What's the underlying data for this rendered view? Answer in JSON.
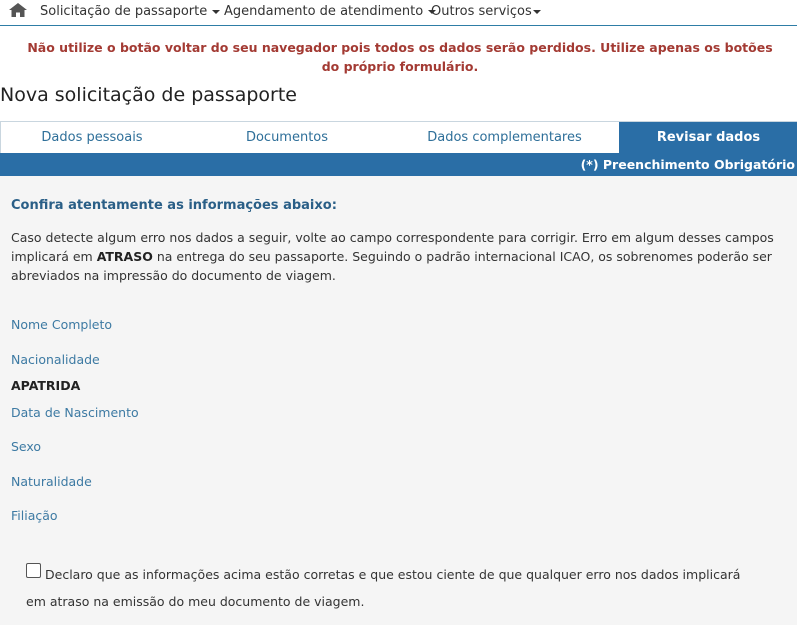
{
  "nav": {
    "home_icon": "home-icon",
    "items": [
      {
        "label": "Solicitação de passaporte"
      },
      {
        "label": "Agendamento de atendimento"
      },
      {
        "label": "Outros serviços"
      }
    ]
  },
  "warning": "Não utilize o botão voltar do seu navegador pois todos os dados serão perdidos. Utilize apenas os botões do próprio formulário.",
  "page_title": "Nova solicitação de passaporte",
  "tabs": [
    {
      "label": "Dados pessoais"
    },
    {
      "label": "Documentos"
    },
    {
      "label": "Dados complementares"
    },
    {
      "label": "Revisar dados",
      "active": true
    }
  ],
  "required_note": "(*) Preenchimento Obrigatório",
  "review": {
    "heading": "Confira atentamente as informações abaixo:",
    "desc_part1": "Caso detecte algum erro nos dados a seguir, volte ao campo correspondente para corrigir. Erro em algum desses campos implicará em ",
    "desc_bold": "ATRASO",
    "desc_part2": " na entrega do seu passaporte. Seguindo o padrão internacional ICAO, os sobrenomes poderão ser abreviados na impressão do documento de viagem.",
    "fields": [
      {
        "label": "Nome Completo",
        "value": ""
      },
      {
        "label": "Nacionalidade",
        "value": "APATRIDA"
      },
      {
        "label": "Data de Nascimento",
        "value": ""
      },
      {
        "label": "Sexo",
        "value": ""
      },
      {
        "label": "Naturalidade",
        "value": ""
      },
      {
        "label": "Filiação",
        "value": ""
      }
    ]
  },
  "declaration": {
    "line1": "Declaro que as informações acima estão corretas e que estou ciente de que qualquer erro nos dados implicará",
    "line2": "em atraso na emissão do meu documento de viagem.",
    "checked": false
  },
  "colors": {
    "primary": "#2a6ea6",
    "warning": "#a33a33",
    "label": "#3d7aa3",
    "panel_bg": "#f5f5f5"
  }
}
